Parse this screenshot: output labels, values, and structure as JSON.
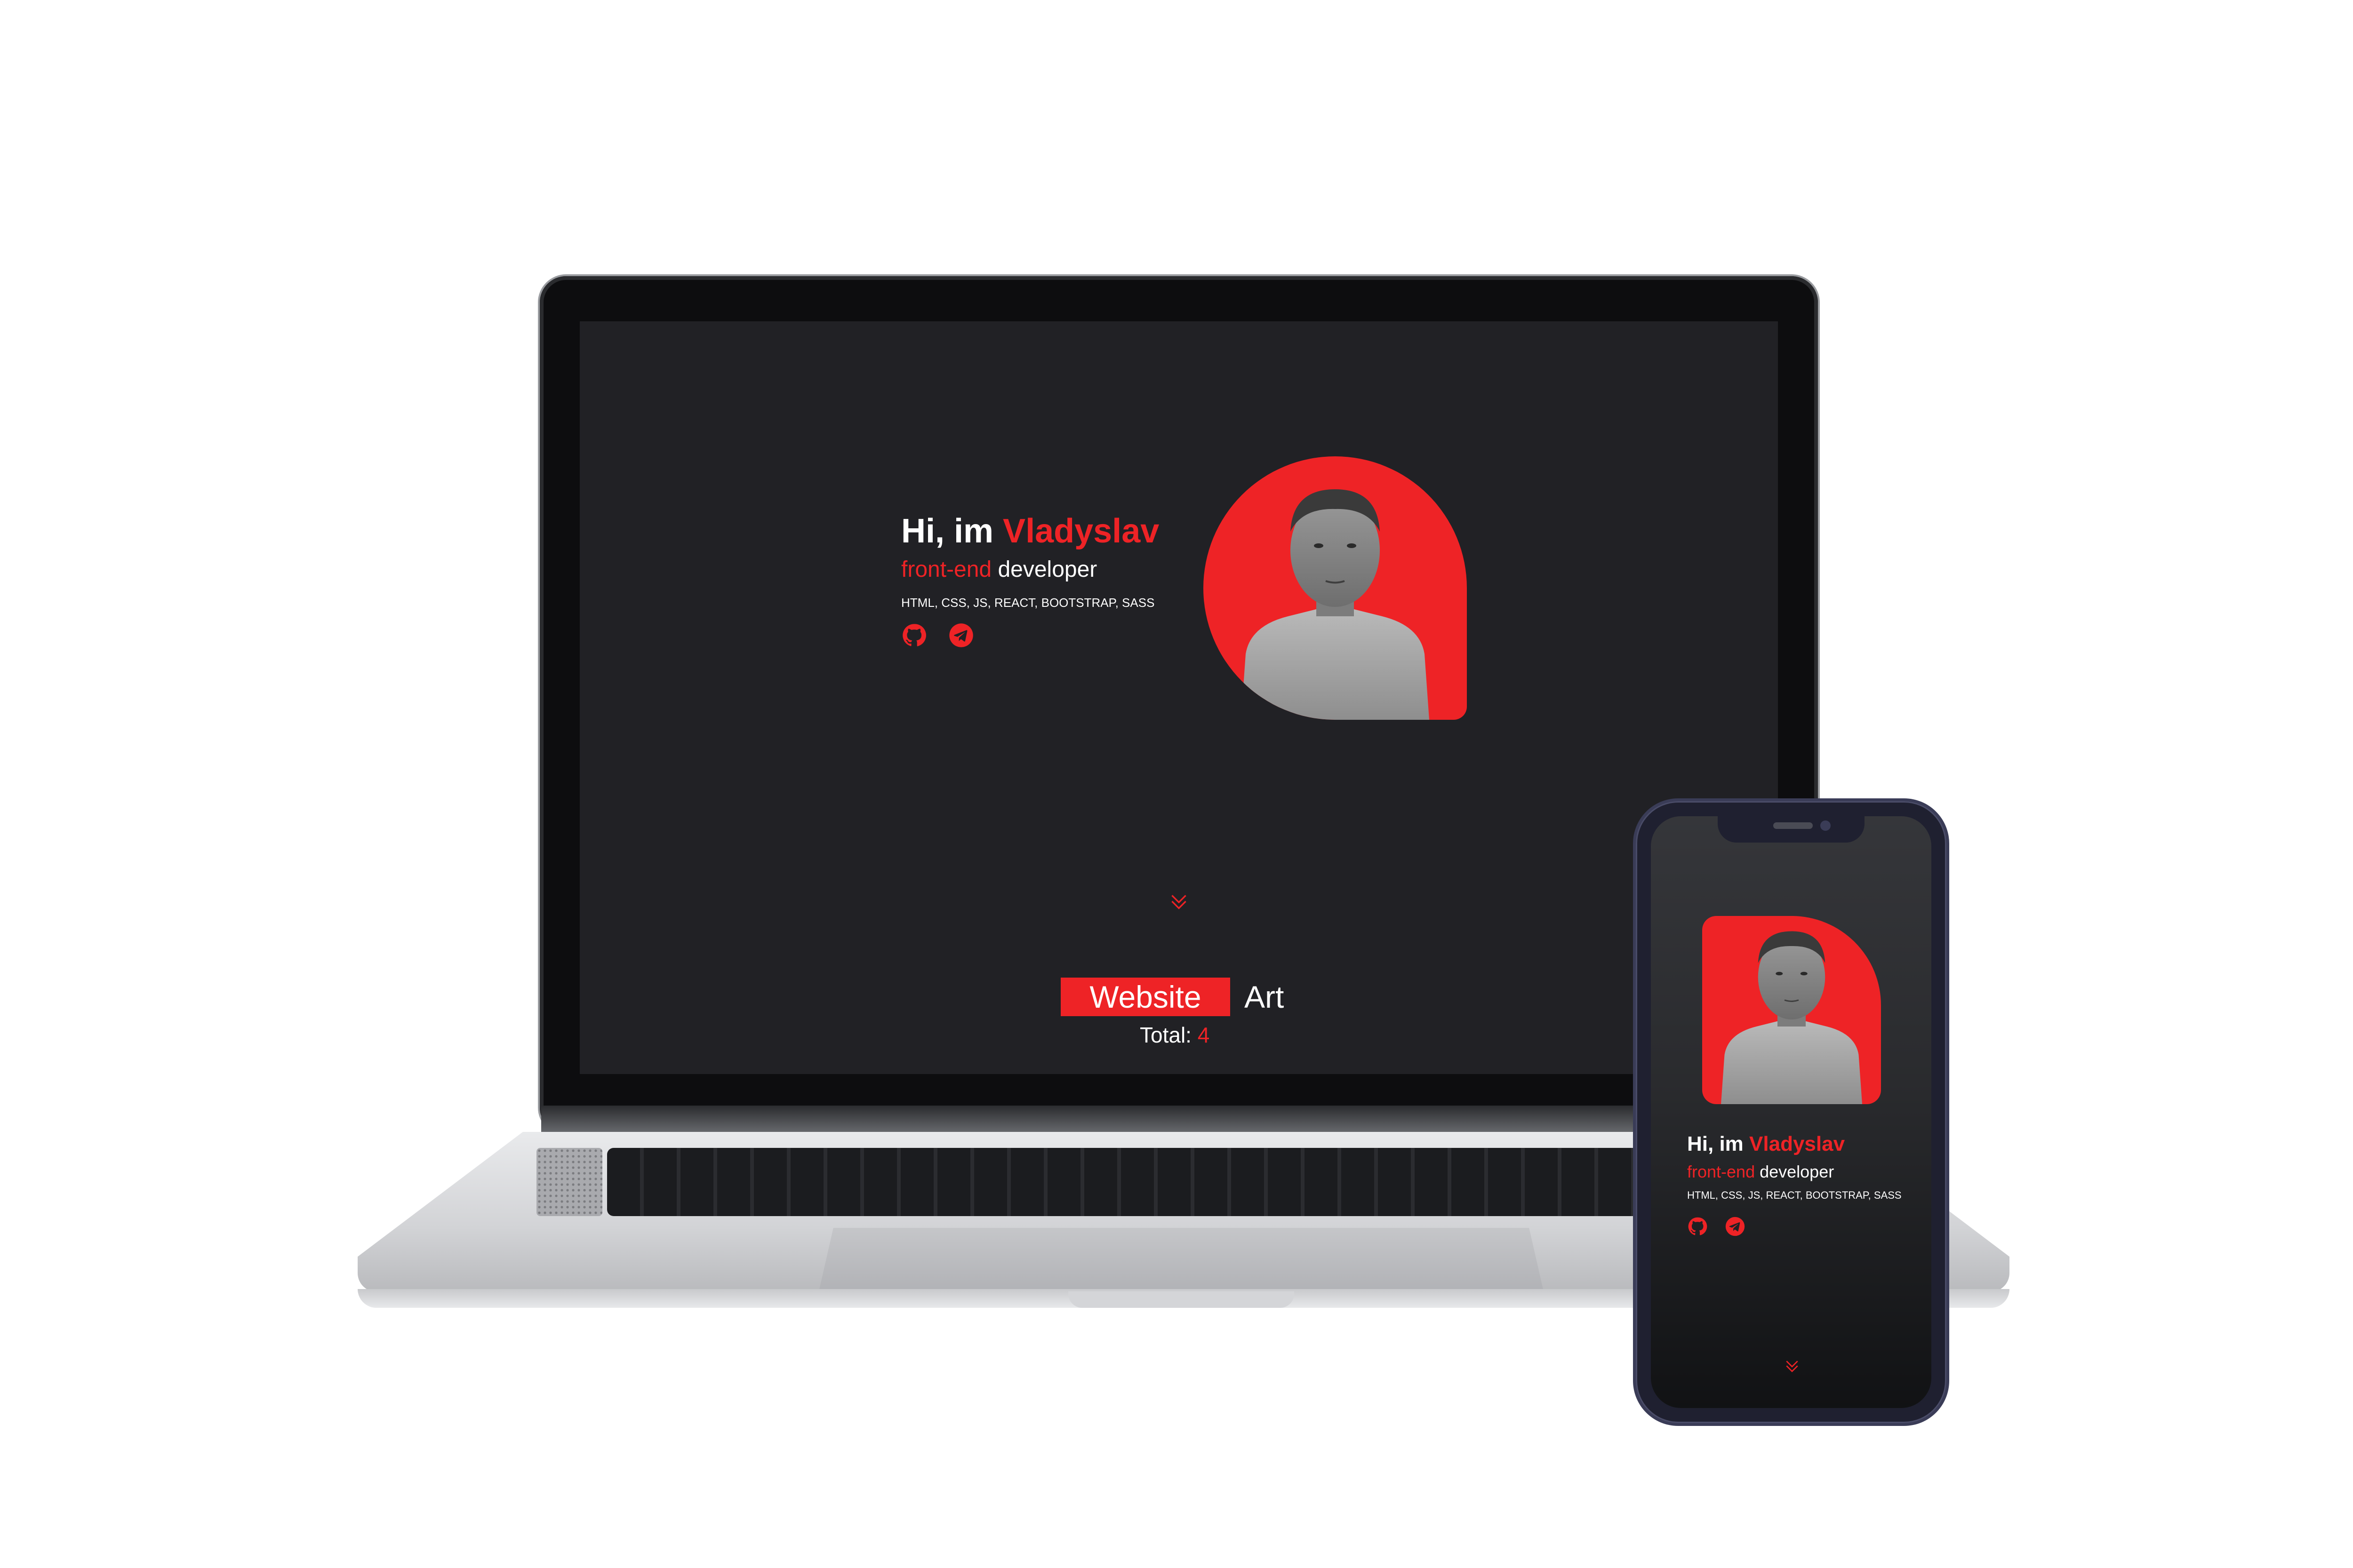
{
  "hero": {
    "greeting_prefix": "Hi, im ",
    "name": "Vladyslav",
    "role_highlight": "front-end",
    "role_rest": " developer",
    "skills": "HTML, CSS, JS, REACT, BOOTSTRAP, SASS",
    "socials": [
      {
        "icon": "github-icon"
      },
      {
        "icon": "telegram-icon"
      }
    ]
  },
  "tabs": {
    "website_label": "Website",
    "art_label": "Art",
    "total_label": "Total: ",
    "total_value": "4"
  },
  "colors": {
    "accent": "#ee2326",
    "background": "#212125",
    "text": "#ffffff"
  }
}
